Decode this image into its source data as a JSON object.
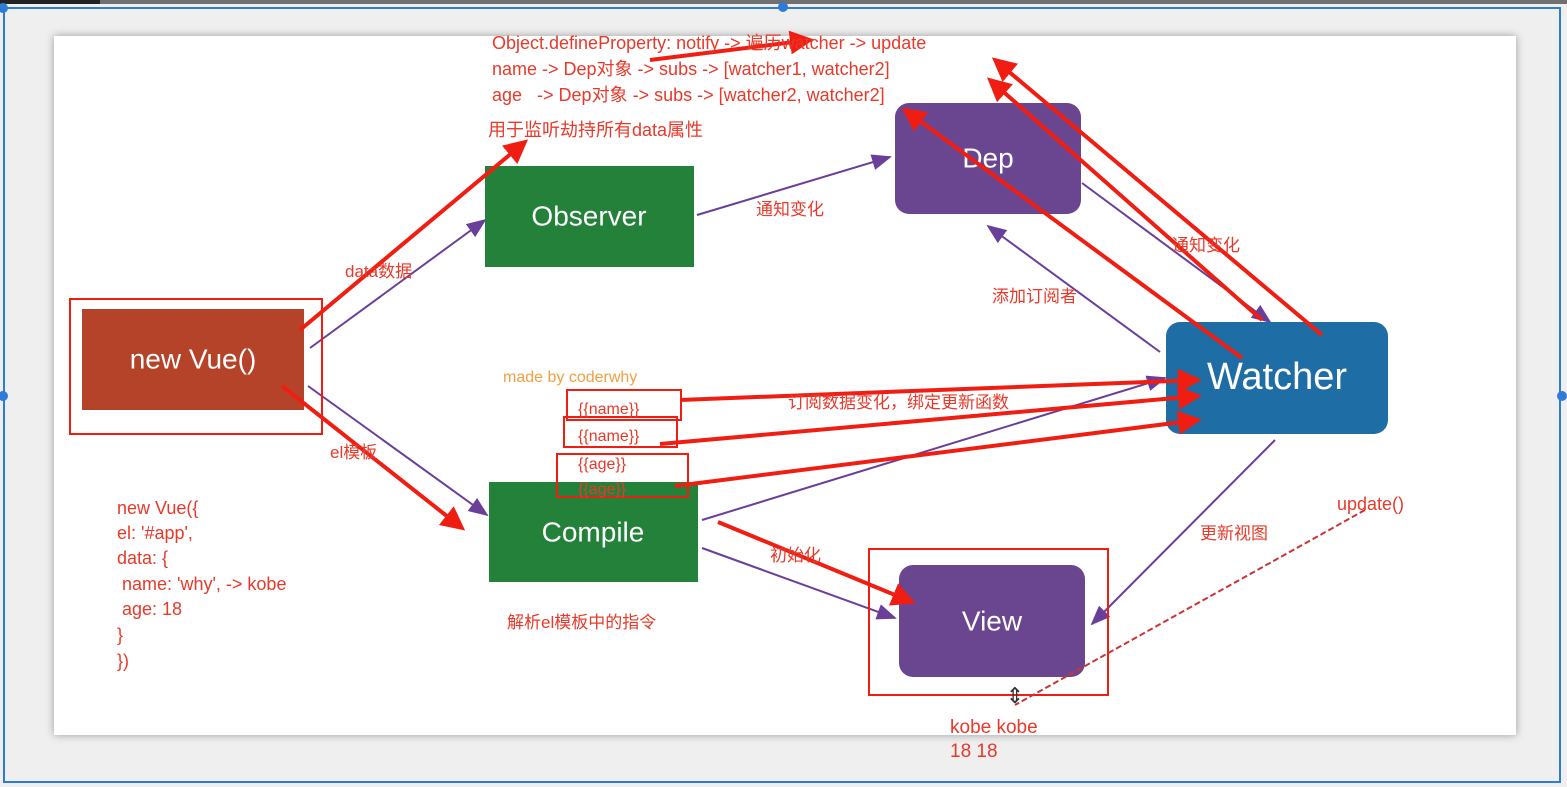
{
  "notes": {
    "line1": "Object.defineProperty: notify -> 遍历watcher -> update",
    "line2": "name -> Dep对象 -> subs -> [watcher1, watcher2]",
    "line3": "age   -> Dep对象 -> subs -> [watcher2, watcher2]",
    "observer_caption": "用于监听劫持所有data属性"
  },
  "nodes": {
    "new_vue": "new Vue()",
    "observer": "Observer",
    "dep": "Dep",
    "watcher": "Watcher",
    "compile": "Compile",
    "view": "View"
  },
  "edge_labels": {
    "data": "data数据",
    "el": "el模板",
    "notify1": "通知变化",
    "notify2": "通知变化",
    "add_subscriber": "添加订阅者",
    "subscribe": "订阅数据变化，绑定更新函数",
    "init": "初始化",
    "update_view": "更新视图",
    "compile_caption": "解析el模板中的指令",
    "update_fn": "update()"
  },
  "credit": "made by coderwhy",
  "templates": [
    "{{name}}",
    "{{name}}",
    "{{age}}",
    "{{age}}"
  ],
  "code": [
    "new Vue({",
    "el: '#app',",
    "data: {",
    " name: 'why', -> kobe",
    " age: 18",
    "}",
    "})"
  ],
  "view_output": [
    "kobe kobe",
    "18 18"
  ],
  "colors": {
    "observer": "#23813a",
    "compile": "#23813a",
    "new_vue": "#b5432a",
    "dep": "#6b4690",
    "view": "#6b4690",
    "watcher": "#1f6da5",
    "annotation": "#f01e12"
  }
}
